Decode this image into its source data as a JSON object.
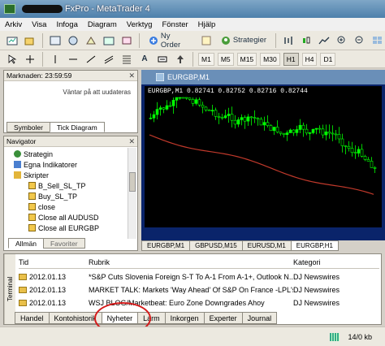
{
  "window": {
    "title": "FxPro - MetaTrader 4"
  },
  "menu": [
    "Arkiv",
    "Visa",
    "Infoga",
    "Diagram",
    "Verktyg",
    "Fönster",
    "Hjälp"
  ],
  "toolbar": {
    "new_order": "Ny Order",
    "strategies": "Strategier"
  },
  "periods": [
    "M1",
    "M5",
    "M15",
    "M30",
    "H1",
    "H4",
    "D1"
  ],
  "active_period": "H1",
  "market": {
    "title": "Marknaden: 23:59:59",
    "waiting": "Väntar på att uudateras",
    "tabs": [
      "Symboler",
      "Tick Diagram"
    ]
  },
  "navigator": {
    "title": "Navigator",
    "items": [
      {
        "label": "Strategin",
        "icon": "strategy-icon"
      },
      {
        "label": "Egna Indikatorer",
        "icon": "indicator-icon"
      },
      {
        "label": "Skripter",
        "icon": "script-folder-icon"
      },
      {
        "label": "B_Sell_SL_TP",
        "icon": "script-icon"
      },
      {
        "label": "Buy_SL_TP",
        "icon": "script-icon"
      },
      {
        "label": "close",
        "icon": "script-icon"
      },
      {
        "label": "Close all AUDUSD",
        "icon": "script-icon"
      },
      {
        "label": "Close all EURGBP",
        "icon": "script-icon"
      }
    ],
    "tabs": [
      "Allmän",
      "Favoriter"
    ]
  },
  "chart": {
    "window_title": "EURGBP,M1",
    "header": "EURGBP,M1  0.82741  0.82752  0.82716  0.82744",
    "tabs": [
      "EURGBP,M1",
      "GBPUSD,M15",
      "EURUSD,M1",
      "EURGBP,H1"
    ],
    "active_tab": "EURGBP,H1",
    "candle_color": "#00ff00",
    "ma_color": "#c0392b"
  },
  "terminal": {
    "side_label": "Terminal",
    "columns": [
      "Tid",
      "Rubrik",
      "Kategori"
    ],
    "rows": [
      {
        "time": "2012.01.13",
        "rubrik": "*S&P Cuts Slovenia Foreign S-T To A-1 From A-1+, Outlook N...",
        "kategori": "DJ Newswires"
      },
      {
        "time": "2012.01.13",
        "rubrik": "MARKET TALK: Markets 'Way Ahead' Of S&P On France -LPL's ...",
        "kategori": "DJ Newswires"
      },
      {
        "time": "2012.01.13",
        "rubrik": "WSJ BLOG/Marketbeat: Euro Zone Downgrades Ahoy",
        "kategori": "DJ Newswires"
      }
    ],
    "tabs": [
      "Handel",
      "Kontohistorik",
      "Nyheter",
      "Larm",
      "Inkorgen",
      "Experter",
      "Journal"
    ],
    "active_tab": "Nyheter"
  },
  "status": {
    "traffic": "14/0 kb"
  }
}
